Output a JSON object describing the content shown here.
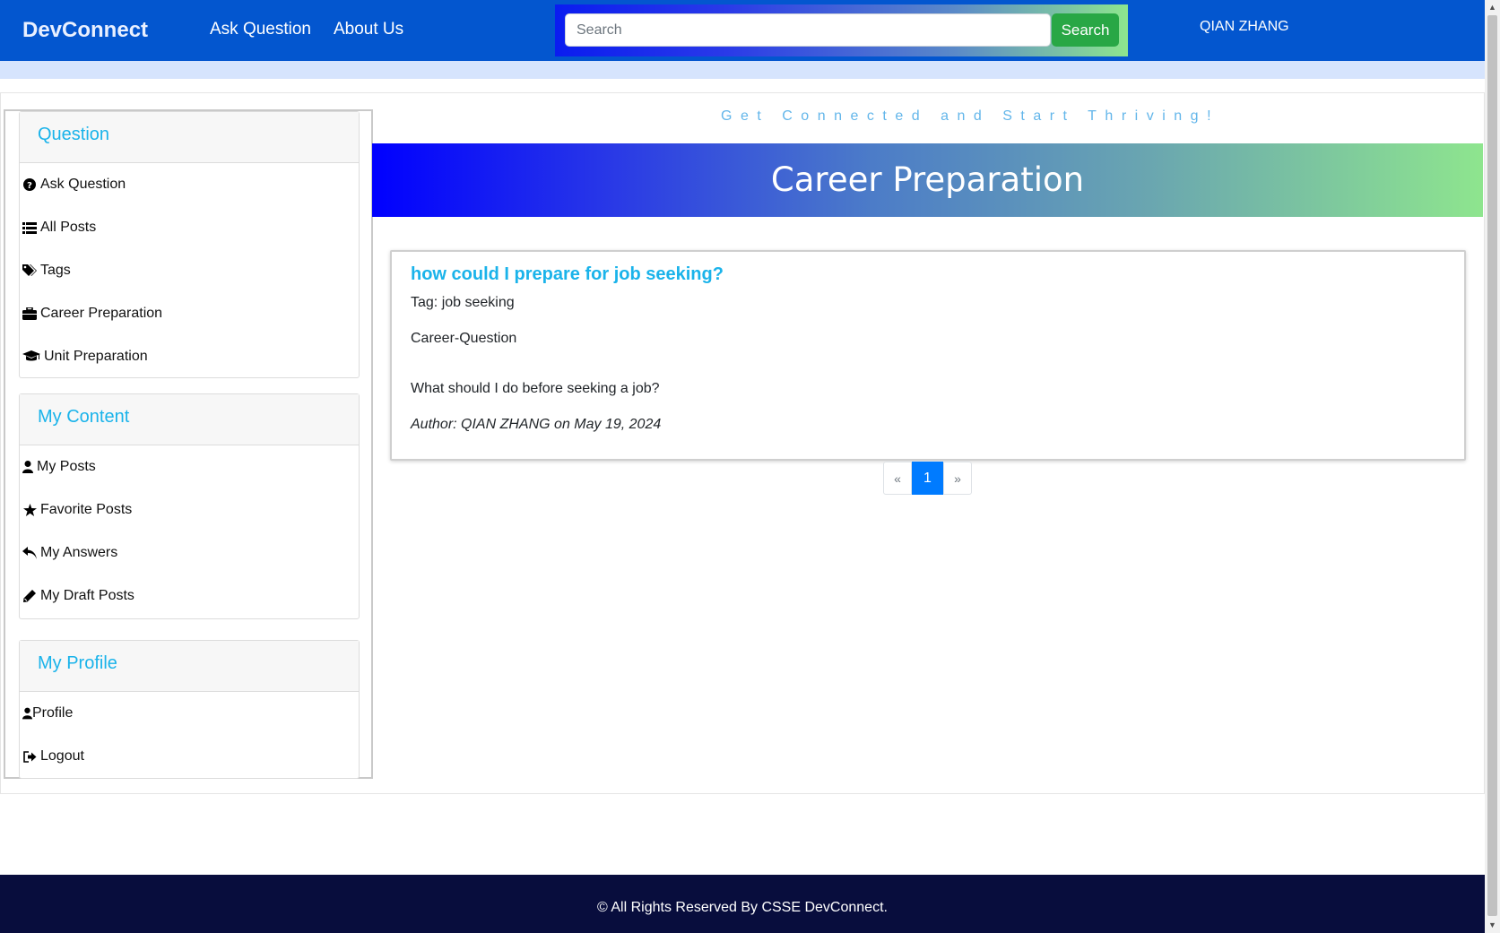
{
  "navbar": {
    "brand": "DevConnect",
    "links": [
      {
        "label": "Ask Question"
      },
      {
        "label": "About Us"
      }
    ],
    "search": {
      "placeholder": "Search",
      "value": "",
      "button": "Search"
    },
    "user": "QIAN ZHANG"
  },
  "sidebar": {
    "sections": [
      {
        "title": "Question",
        "items": [
          {
            "label": "Ask Question",
            "icon": "question-circle-icon"
          },
          {
            "label": "All Posts",
            "icon": "list-icon"
          },
          {
            "label": "Tags",
            "icon": "tags-icon"
          },
          {
            "label": "Career Preparation",
            "icon": "briefcase-icon"
          },
          {
            "label": "Unit Preparation",
            "icon": "graduation-cap-icon"
          }
        ]
      },
      {
        "title": "My Content",
        "items": [
          {
            "label": "My Posts",
            "icon": "user-icon"
          },
          {
            "label": "Favorite Posts",
            "icon": "star-icon"
          },
          {
            "label": "My Answers",
            "icon": "reply-icon"
          },
          {
            "label": "My Draft Posts",
            "icon": "pencil-icon"
          }
        ]
      },
      {
        "title": "My Profile",
        "items": [
          {
            "label": "Profile",
            "icon": "user-icon"
          },
          {
            "label": "Logout",
            "icon": "sign-out-icon"
          }
        ]
      }
    ]
  },
  "main": {
    "tagline": "Get Connected and Start Thriving!",
    "banner_title": "Career Preparation",
    "posts": [
      {
        "title": "how could I prepare for job seeking?",
        "tag": "Tag: job seeking",
        "category": "Career-Question",
        "body": "What should I do before seeking a job?",
        "author": "Author: QIAN ZHANG on May 19, 2024"
      }
    ],
    "pagination": {
      "prev": "«",
      "current": "1",
      "next": "»"
    }
  },
  "footer": {
    "text": "© All Rights Reserved By CSSE DevConnect."
  },
  "colors": {
    "navbar": "#0356cf",
    "accent_text": "#1ab3ea",
    "search_button": "#28a745",
    "pagination_active": "#007bff",
    "footer": "#080d3d"
  }
}
